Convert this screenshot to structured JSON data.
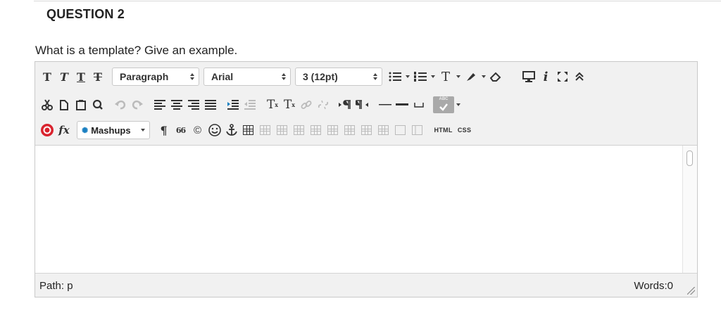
{
  "question": {
    "title": "QUESTION 2",
    "text": "What is a template? Give an example."
  },
  "toolbar": {
    "format_select": "Paragraph",
    "font_select": "Arial",
    "size_select": "3 (12pt)",
    "mashups_label": "Mashups",
    "html_label": "HTML",
    "css_label": "CSS",
    "spell_label": "ABC",
    "glyphs": {
      "bold": "T",
      "italic": "T",
      "underline": "T",
      "strike": "T",
      "text_color": "T",
      "info": "i",
      "superscript": "T",
      "subscript": "T",
      "formula": "fx",
      "pilcrow": "¶",
      "quote": "66",
      "copyright": "©"
    }
  },
  "status": {
    "path_label": "Path: p",
    "word_count": "Words:0"
  },
  "colors": {
    "toolbar_bg": "#f1f1f1",
    "border": "#c9c9c9",
    "icon": "#333333",
    "disabled_icon": "#b9b9b9",
    "accent_blue": "#1a7fc1",
    "record_red": "#d9232e"
  }
}
